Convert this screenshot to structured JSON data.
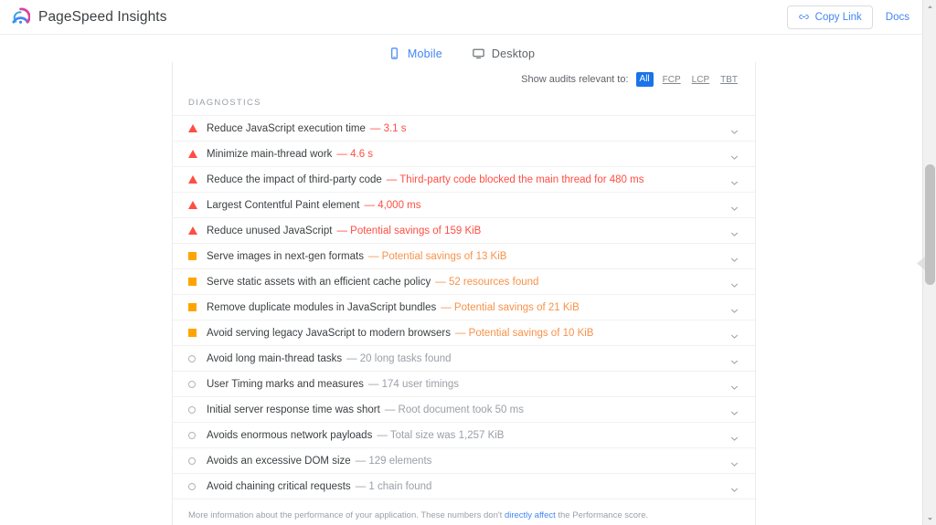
{
  "header": {
    "brand_title": "PageSpeed Insights",
    "logo_icon": "pagespeed-gauge-icon",
    "copy_link_label": "Copy Link",
    "copy_link_icon": "link-icon",
    "docs_label": "Docs"
  },
  "tabs": [
    {
      "label": "Mobile",
      "icon": "mobile-phone-icon",
      "active": true
    },
    {
      "label": "Desktop",
      "icon": "desktop-monitor-icon",
      "active": false
    }
  ],
  "filters": {
    "label": "Show audits relevant to:",
    "options": [
      {
        "label": "All",
        "active": true
      },
      {
        "label": "FCP",
        "active": false
      },
      {
        "label": "LCP",
        "active": false
      },
      {
        "label": "TBT",
        "active": false
      }
    ]
  },
  "section": {
    "title": "DIAGNOSTICS"
  },
  "audits": [
    {
      "icon": "triangle",
      "severity": "fail",
      "title": "Reduce JavaScript execution time",
      "value": "— 3.1 s"
    },
    {
      "icon": "triangle",
      "severity": "fail",
      "title": "Minimize main-thread work",
      "value": "— 4.6 s"
    },
    {
      "icon": "triangle",
      "severity": "fail",
      "title": "Reduce the impact of third-party code",
      "value": "— Third-party code blocked the main thread for 480 ms"
    },
    {
      "icon": "triangle",
      "severity": "fail",
      "title": "Largest Contentful Paint element",
      "value": "— 4,000 ms"
    },
    {
      "icon": "triangle",
      "severity": "fail",
      "title": "Reduce unused JavaScript",
      "value": "— Potential savings of 159 KiB"
    },
    {
      "icon": "square",
      "severity": "average",
      "title": "Serve images in next-gen formats",
      "value": "— Potential savings of 13 KiB"
    },
    {
      "icon": "square",
      "severity": "average",
      "title": "Serve static assets with an efficient cache policy",
      "value": "— 52 resources found"
    },
    {
      "icon": "square",
      "severity": "average",
      "title": "Remove duplicate modules in JavaScript bundles",
      "value": "— Potential savings of 21 KiB"
    },
    {
      "icon": "square",
      "severity": "average",
      "title": "Avoid serving legacy JavaScript to modern browsers",
      "value": "— Potential savings of 10 KiB"
    },
    {
      "icon": "circle",
      "severity": "pass",
      "title": "Avoid long main-thread tasks",
      "value": "— 20 long tasks found"
    },
    {
      "icon": "circle",
      "severity": "pass",
      "title": "User Timing marks and measures",
      "value": "— 174 user timings"
    },
    {
      "icon": "circle",
      "severity": "pass",
      "title": "Initial server response time was short",
      "value": "— Root document took 50 ms"
    },
    {
      "icon": "circle",
      "severity": "pass",
      "title": "Avoids enormous network payloads",
      "value": "— Total size was 1,257 KiB"
    },
    {
      "icon": "circle",
      "severity": "pass",
      "title": "Avoids an excessive DOM size",
      "value": "— 129 elements"
    },
    {
      "icon": "circle",
      "severity": "pass",
      "title": "Avoid chaining critical requests",
      "value": "— 1 chain found"
    }
  ],
  "footer": {
    "text_before": "More information about the performance of your application. These numbers don't ",
    "link_text": "directly affect",
    "text_after": " the Performance score."
  },
  "colors": {
    "accent_blue": "#4285f4",
    "chip_blue": "#1a73e8",
    "fail_red": "#ff4e42",
    "average_orange": "#ffa400",
    "average_text": "#f7924a",
    "pass_gray": "#9aa0a6",
    "text_primary": "#3c4043"
  }
}
